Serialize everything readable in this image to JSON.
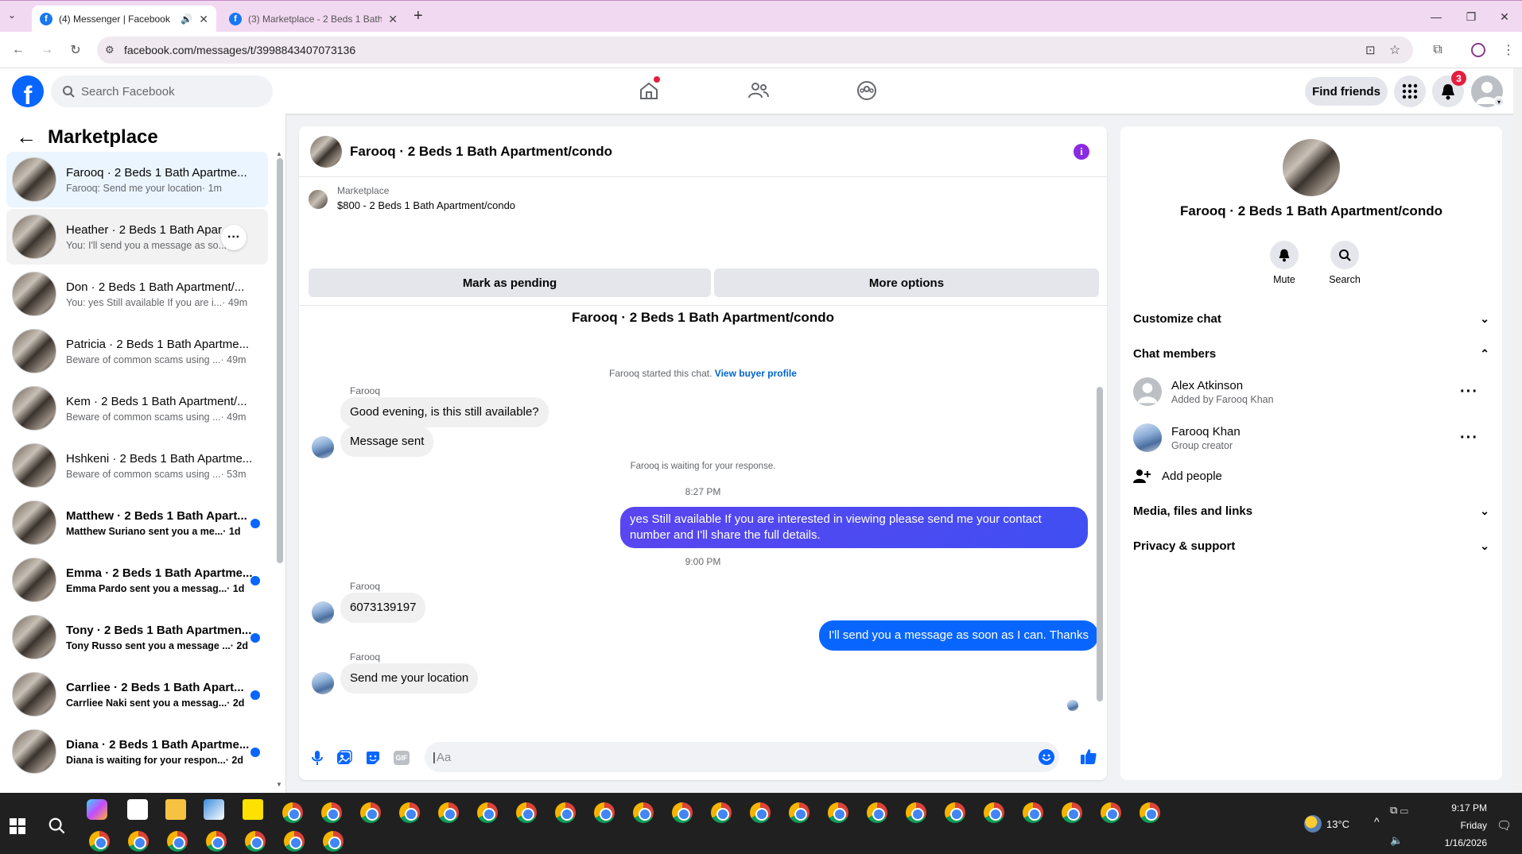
{
  "browser": {
    "tabs": [
      {
        "title": "(4) Messenger | Facebook",
        "active": true
      },
      {
        "title": "(3) Marketplace - 2 Beds 1 Bath",
        "active": false
      }
    ],
    "url": "facebook.com/messages/t/3998843407073136"
  },
  "fb_header": {
    "search_placeholder": "Search Facebook",
    "find_friends_label": "Find friends",
    "notifications_count": "3"
  },
  "left_panel": {
    "title": "Marketplace",
    "conversations": [
      {
        "name": "Farooq · 2 Beds 1 Bath Apartme...",
        "preview": "Farooq: Send me your location",
        "time": " · 1m",
        "unread": false,
        "selected": true
      },
      {
        "name": "Heather · 2 Beds 1 Bath Apar...",
        "preview": "You: I'll send you a message as so...",
        "time": "",
        "unread": false,
        "selected": false
      },
      {
        "name": "Don · 2 Beds 1 Bath Apartment/...",
        "preview": "You: yes Still available If you are i...",
        "time": " · 49m",
        "unread": false,
        "selected": false
      },
      {
        "name": "Patricia · 2 Beds 1 Bath Apartme...",
        "preview": "Beware of common scams using ...",
        "time": " · 49m",
        "unread": false,
        "selected": false
      },
      {
        "name": "Kem · 2 Beds 1 Bath Apartment/...",
        "preview": "Beware of common scams using ...",
        "time": " · 49m",
        "unread": false,
        "selected": false
      },
      {
        "name": "Hshkeni · 2 Beds 1 Bath Apartme...",
        "preview": "Beware of common scams using ...",
        "time": " · 53m",
        "unread": false,
        "selected": false
      },
      {
        "name": "Matthew · 2 Beds 1 Bath Apart...",
        "preview": "Matthew Suriano sent you a me...",
        "time": " · 1d",
        "unread": true,
        "selected": false
      },
      {
        "name": "Emma · 2 Beds 1 Bath Apartme...",
        "preview": "Emma Pardo sent you a messag...",
        "time": " · 1d",
        "unread": true,
        "selected": false
      },
      {
        "name": "Tony · 2 Beds 1 Bath Apartmen...",
        "preview": "Tony Russo sent you a message ...",
        "time": " · 2d",
        "unread": true,
        "selected": false
      },
      {
        "name": "Carrliee · 2 Beds 1 Bath Apart...",
        "preview": "Carrliee Naki sent you a messag...",
        "time": " · 2d",
        "unread": true,
        "selected": false
      },
      {
        "name": "Diana · 2 Beds 1 Bath Apartme...",
        "preview": "Diana is waiting for your respon...",
        "time": " · 2d",
        "unread": true,
        "selected": false
      }
    ]
  },
  "chat": {
    "title": "Farooq · 2 Beds 1 Bath Apartment/condo",
    "listing_source": "Marketplace",
    "listing_title": "$800 - 2 Beds 1 Bath Apartment/condo",
    "mark_pending_label": "Mark as pending",
    "more_options_label": "More options",
    "intro_title": "Farooq · 2 Beds 1 Bath Apartment/condo",
    "started_note": "Farooq started this chat.",
    "view_profile_link": "View buyer profile",
    "sender_name": "Farooq",
    "msg1": "Good evening, is this still available?",
    "msg2": "Message sent",
    "waiting_note": "Farooq is waiting for your response.",
    "time1": "8:27 PM",
    "out_msg1": "yes Still available If you are interested in viewing please send me your contact number and I'll share the full details.",
    "time2": "9:00 PM",
    "msg3": "6073139197",
    "out_msg2": "I'll send you a message as soon as I can. Thanks",
    "msg4": "Send me your location",
    "composer_placeholder": "Aa"
  },
  "right_panel": {
    "title": "Farooq · 2 Beds 1 Bath Apartment/condo",
    "mute_label": "Mute",
    "search_label": "Search",
    "customize_chat": "Customize chat",
    "chat_members": "Chat members",
    "members": [
      {
        "name": "Alex Atkinson",
        "sub": "Added by Farooq Khan"
      },
      {
        "name": "Farooq Khan",
        "sub": "Group creator"
      }
    ],
    "add_people": "Add people",
    "media_files": "Media, files and links",
    "privacy_support": "Privacy & support"
  },
  "taskbar": {
    "weather": "13°C",
    "time": "9:17 PM",
    "day": "Friday",
    "date": "1/16/2026"
  },
  "colors": {
    "accent": "#0866ff",
    "outgoing_gradient": "#5b45f0",
    "purple_info": "#8a2be2"
  }
}
